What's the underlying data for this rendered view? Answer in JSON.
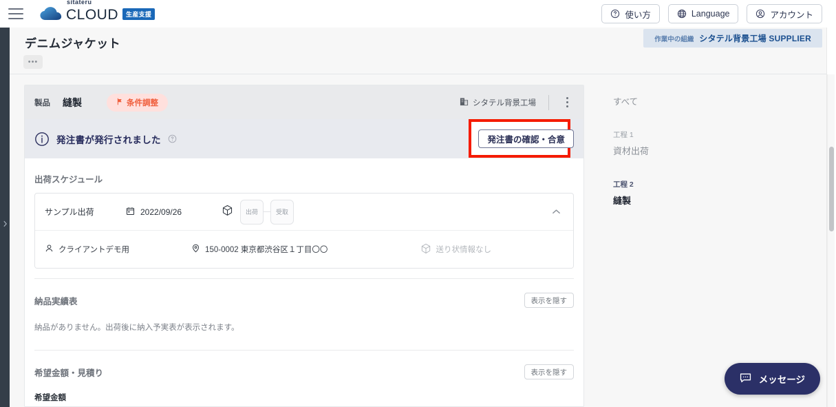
{
  "topbar": {
    "menu_icon": "hamburger-icon",
    "brand": {
      "sitateru": "sitateru",
      "cloud": "CLOUD",
      "badge": "生産支援"
    },
    "buttons": [
      {
        "icon": "question-circle-icon",
        "label": "使い方"
      },
      {
        "icon": "globe-icon",
        "label": "Language"
      },
      {
        "icon": "account-circle-icon",
        "label": "アカウント"
      }
    ]
  },
  "org_ribbon": {
    "label": "作業中の組織",
    "value": "シタテル背景工場 SUPPLIER"
  },
  "page": {
    "title": "デニムジャケット",
    "more_label": "•••"
  },
  "card": {
    "header": {
      "kind": "製品",
      "name": "縫製",
      "badge": "条件調整",
      "badge_icon": "flag-icon",
      "factory_icon": "building-icon",
      "factory": "シタテル背景工場",
      "kebab_icon": "more-vertical-icon"
    },
    "alert": {
      "icon": "info-circle-icon",
      "text": "発注書が発行されました",
      "help_icon": "help-circle-icon",
      "cta_label": "発注書の確認・合意"
    },
    "shipping": {
      "title": "出荷スケジュール",
      "row": {
        "name": "サンプル出荷",
        "calendar_icon": "calendar-icon",
        "date": "2022/09/26",
        "package_icon": "package-icon",
        "steps": [
          "出荷",
          "受取"
        ],
        "chevron_icon": "chevron-up-icon"
      },
      "detail": {
        "person_icon": "person-icon",
        "person": "クライアントデモ用",
        "pin_icon": "location-pin-icon",
        "address": "150-0002 東京都渋谷区１丁目〇〇",
        "waybill_icon": "package-icon",
        "waybill": "送り状情報なし"
      }
    },
    "delivery": {
      "title": "納品実績表",
      "toggle_label": "表示を隠す",
      "note": "納品がありません。出荷後に納入予実表が表示されます。"
    },
    "quote": {
      "title": "希望金額・見積り",
      "toggle_label": "表示を隠す",
      "sub_label": "希望金額"
    }
  },
  "side_nav": {
    "all_label": "すべて",
    "groups": [
      {
        "step": "工程 1",
        "name": "資材出荷",
        "active": false
      },
      {
        "step": "工程 2",
        "name": "縫製",
        "active": true
      }
    ]
  },
  "message_fab": {
    "icon": "chat-icon",
    "label": "メッセージ"
  },
  "colors": {
    "accent_navy": "#2b3067",
    "badge_pink_bg": "#ffe0dd",
    "badge_pink_fg": "#f0603f",
    "highlight_red": "#f51b00",
    "brand_blue": "#1a68b8"
  }
}
